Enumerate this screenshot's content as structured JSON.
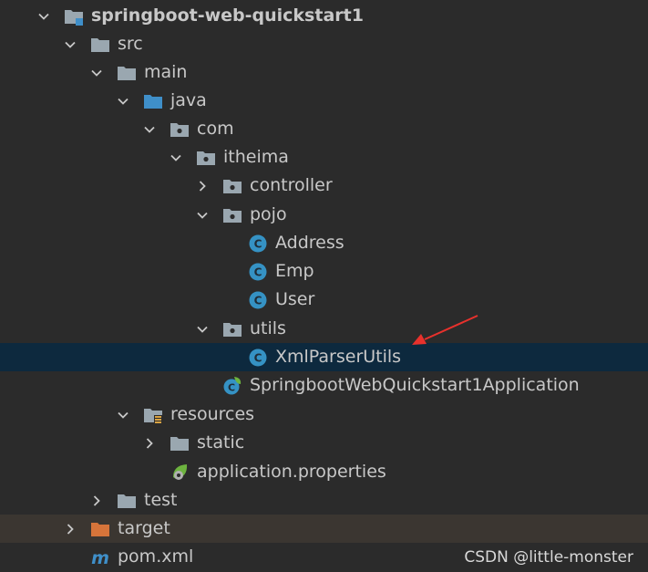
{
  "project_tree": {
    "project": {
      "name": "springboot-web-quickstart1",
      "icon": "module-folder-icon"
    },
    "src": {
      "name": "src",
      "icon": "folder-icon"
    },
    "main": {
      "name": "main",
      "icon": "folder-icon"
    },
    "java": {
      "name": "java",
      "icon": "source-root-folder-icon"
    },
    "com": {
      "name": "com",
      "icon": "package-icon"
    },
    "itheima": {
      "name": "itheima",
      "icon": "package-icon"
    },
    "controller": {
      "name": "controller",
      "icon": "package-icon"
    },
    "pojo": {
      "name": "pojo",
      "icon": "package-icon"
    },
    "address": {
      "name": "Address",
      "icon": "class-icon"
    },
    "emp": {
      "name": "Emp",
      "icon": "class-icon"
    },
    "user": {
      "name": "User",
      "icon": "class-icon"
    },
    "utils": {
      "name": "utils",
      "icon": "package-icon"
    },
    "xml_parser_utils": {
      "name": "XmlParserUtils",
      "icon": "class-icon",
      "selected": true
    },
    "application_class": {
      "name": "SpringbootWebQuickstart1Application",
      "icon": "spring-boot-class-icon"
    },
    "resources": {
      "name": "resources",
      "icon": "resources-root-folder-icon"
    },
    "static": {
      "name": "static",
      "icon": "folder-icon"
    },
    "application_properties": {
      "name": "application.properties",
      "icon": "spring-properties-icon"
    },
    "test": {
      "name": "test",
      "icon": "folder-icon"
    },
    "target": {
      "name": "target",
      "icon": "excluded-folder-icon"
    },
    "pom": {
      "name": "pom.xml",
      "icon": "maven-icon"
    }
  },
  "watermark": "CSDN @little-monster",
  "colors": {
    "background": "#2b2b2b",
    "selection": "#0d293e",
    "excluded_row": "#3b3631",
    "folder": "#9aa7b0",
    "source_root": "#3f8fc9",
    "excluded_folder": "#d6743a",
    "class_circle": "#3592c4",
    "annotation_arrow": "#e8312c"
  }
}
